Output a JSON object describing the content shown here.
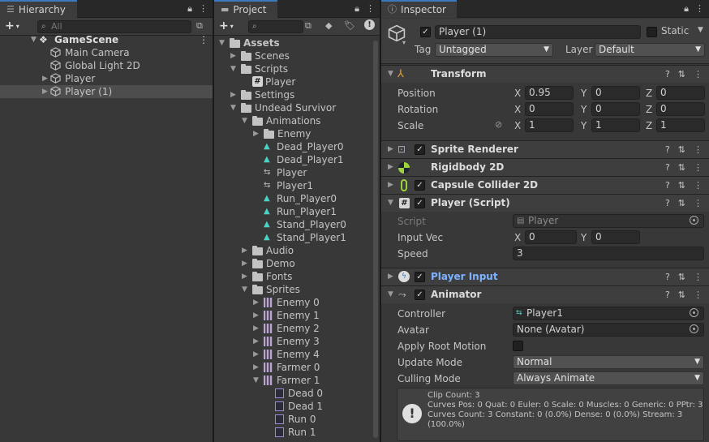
{
  "hierarchy": {
    "tab": "Hierarchy",
    "search_placeholder": "All",
    "scene": "GameScene",
    "items": [
      {
        "label": "Main Camera"
      },
      {
        "label": "Global Light 2D"
      },
      {
        "label": "Player"
      },
      {
        "label": "Player (1)"
      }
    ]
  },
  "project": {
    "tab": "Project",
    "tree": [
      {
        "label": "Assets",
        "kind": "folder",
        "depth": 0,
        "arrow": "down"
      },
      {
        "label": "Scenes",
        "kind": "folder",
        "depth": 1,
        "arrow": "right"
      },
      {
        "label": "Scripts",
        "kind": "folder",
        "depth": 1,
        "arrow": "down"
      },
      {
        "label": "Player",
        "kind": "script",
        "depth": 2,
        "arrow": ""
      },
      {
        "label": "Settings",
        "kind": "folder",
        "depth": 1,
        "arrow": "right"
      },
      {
        "label": "Undead Survivor",
        "kind": "folder",
        "depth": 1,
        "arrow": "down"
      },
      {
        "label": "Animations",
        "kind": "folder",
        "depth": 2,
        "arrow": "down"
      },
      {
        "label": "Enemy",
        "kind": "folder",
        "depth": 3,
        "arrow": "right"
      },
      {
        "label": "Dead_Player0",
        "kind": "anim",
        "depth": 3,
        "arrow": ""
      },
      {
        "label": "Dead_Player1",
        "kind": "anim",
        "depth": 3,
        "arrow": ""
      },
      {
        "label": "Player",
        "kind": "controller",
        "depth": 3,
        "arrow": ""
      },
      {
        "label": "Player1",
        "kind": "controller",
        "depth": 3,
        "arrow": ""
      },
      {
        "label": "Run_Player0",
        "kind": "anim",
        "depth": 3,
        "arrow": ""
      },
      {
        "label": "Run_Player1",
        "kind": "anim",
        "depth": 3,
        "arrow": ""
      },
      {
        "label": "Stand_Player0",
        "kind": "anim",
        "depth": 3,
        "arrow": ""
      },
      {
        "label": "Stand_Player1",
        "kind": "anim",
        "depth": 3,
        "arrow": ""
      },
      {
        "label": "Audio",
        "kind": "folder",
        "depth": 2,
        "arrow": "right"
      },
      {
        "label": "Demo",
        "kind": "folder",
        "depth": 2,
        "arrow": "right"
      },
      {
        "label": "Fonts",
        "kind": "folder",
        "depth": 2,
        "arrow": "right"
      },
      {
        "label": "Sprites",
        "kind": "folder",
        "depth": 2,
        "arrow": "down"
      },
      {
        "label": "Enemy 0",
        "kind": "sprite",
        "depth": 3,
        "arrow": "right"
      },
      {
        "label": "Enemy 1",
        "kind": "sprite",
        "depth": 3,
        "arrow": "right"
      },
      {
        "label": "Enemy 2",
        "kind": "sprite",
        "depth": 3,
        "arrow": "right"
      },
      {
        "label": "Enemy 3",
        "kind": "sprite",
        "depth": 3,
        "arrow": "right"
      },
      {
        "label": "Enemy 4",
        "kind": "sprite",
        "depth": 3,
        "arrow": "right"
      },
      {
        "label": "Farmer 0",
        "kind": "sprite",
        "depth": 3,
        "arrow": "right"
      },
      {
        "label": "Farmer 1",
        "kind": "sprite",
        "depth": 3,
        "arrow": "down"
      },
      {
        "label": "Dead 0",
        "kind": "subsprite",
        "depth": 4,
        "arrow": ""
      },
      {
        "label": "Dead 1",
        "kind": "subsprite",
        "depth": 4,
        "arrow": ""
      },
      {
        "label": "Run 0",
        "kind": "subsprite",
        "depth": 4,
        "arrow": ""
      },
      {
        "label": "Run 1",
        "kind": "subsprite",
        "depth": 4,
        "arrow": ""
      }
    ]
  },
  "inspector": {
    "tab": "Inspector",
    "object_name": "Player (1)",
    "static_label": "Static",
    "tag_label": "Tag",
    "tag_value": "Untagged",
    "layer_label": "Layer",
    "layer_value": "Default",
    "transform": {
      "title": "Transform",
      "position_label": "Position",
      "rotation_label": "Rotation",
      "scale_label": "Scale",
      "position": {
        "x": "0.95",
        "y": "0",
        "z": "0"
      },
      "rotation": {
        "x": "0",
        "y": "0",
        "z": "0"
      },
      "scale": {
        "x": "1",
        "y": "1",
        "z": "1"
      }
    },
    "axis": {
      "x": "X",
      "y": "Y",
      "z": "Z"
    },
    "sprite_renderer": "Sprite Renderer",
    "rigidbody": "Rigidbody 2D",
    "capsule": "Capsule Collider 2D",
    "player_script": {
      "title": "Player (Script)",
      "script_label": "Script",
      "script_value": "Player",
      "input_label": "Input Vec",
      "input_x": "0",
      "input_y": "0",
      "speed_label": "Speed",
      "speed_value": "3"
    },
    "player_input": "Player Input",
    "animator": {
      "title": "Animator",
      "controller_label": "Controller",
      "controller_value": "Player1",
      "avatar_label": "Avatar",
      "avatar_value": "None (Avatar)",
      "root_motion_label": "Apply Root Motion",
      "update_label": "Update Mode",
      "update_value": "Normal",
      "culling_label": "Culling Mode",
      "culling_value": "Always Animate",
      "info": [
        "Clip Count: 3",
        "Curves Pos: 0 Quat: 0 Euler: 0 Scale: 0 Muscles: 0 Generic: 0 PPtr: 3",
        "Curves Count: 3 Constant: 0 (0.0%) Dense: 0 (0.0%) Stream: 3",
        "(100.0%)"
      ]
    }
  },
  "colors": {
    "accent": "#3a79bb",
    "link_blue": "#7fb2ff",
    "anim_cyan": "#4dd2c8"
  }
}
